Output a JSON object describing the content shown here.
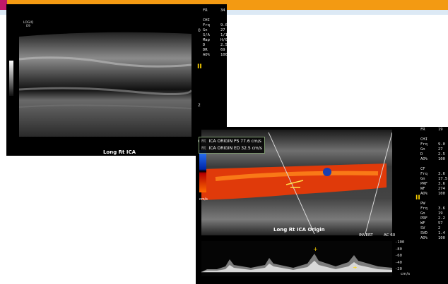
{
  "slide": {
    "accent_orange": "#f39a12",
    "accent_magenta": "#c0186a",
    "header_blue": "#dce9f5"
  },
  "panel1": {
    "logo": "LOGIQ\nE9",
    "caption": "Long Rt ICA",
    "params_labels": "FR\n\nCHI\nFrq\nGn\nS/A\nMap\nD\nDR\nAO%",
    "params_values": "34\n\n\n9.0\n27\n1/1\nH/0\n2.5\n69\n100",
    "depth_mark": "2"
  },
  "panel2": {
    "measurements": [
      {
        "side": "Rt",
        "text": "ICA ORIGIN PS 77.6 cm/s"
      },
      {
        "side": "Rt",
        "text": "ICA ORIGIN ED 32.5 cm/s"
      }
    ],
    "caption": "Long Rt ICA Origin",
    "invert": "INVERT",
    "angle": "AC 60",
    "cms_top": "0",
    "cms_bottom": "cm/s",
    "params_labels": "FR\n\nCHI\nFrq\nGn\nD\nAO%\n\nCF\nFrq\nGn\nPRF\nWF\nAO%\n\nPW\nFrq\nGn\nPRF\nWF\nSV\nSVD\nAO%",
    "params_values": "19\n\n\n9.0\n27\n2.5\n100\n\n\n3.6\n17.5\n3.6\n274\n100\n\n\n3.6\n19\n2.2\n57\n2\n1.4\n100",
    "doppler_scale": "-100\n-80\n-60\n-40\n-20\n",
    "doppler_unit": "cm/s",
    "doppler_bottom": "20"
  }
}
